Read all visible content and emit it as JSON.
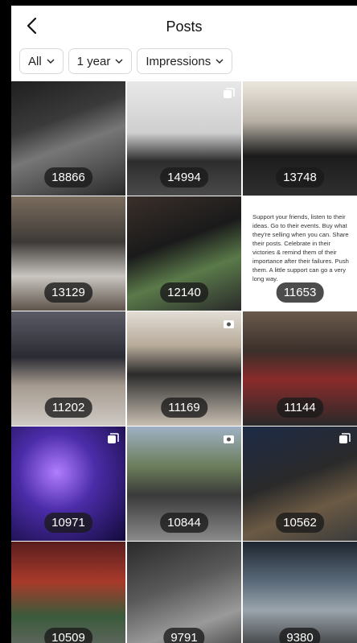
{
  "header": {
    "title": "Posts"
  },
  "filters": [
    {
      "label": "All"
    },
    {
      "label": "1 year"
    },
    {
      "label": "Impressions"
    }
  ],
  "posts": [
    {
      "count": "18866"
    },
    {
      "count": "14994"
    },
    {
      "count": "13748"
    },
    {
      "count": "13129"
    },
    {
      "count": "12140"
    },
    {
      "count": "11653",
      "caption": "Support your friends, listen to their ideas. Go to their events. Buy what they're selling when you can. Share their posts. Celebrate in their victories & remind them of their importance after their failures. Push them. A little support can go a very long way."
    },
    {
      "count": "11202"
    },
    {
      "count": "11169"
    },
    {
      "count": "11144"
    },
    {
      "count": "10971"
    },
    {
      "count": "10844"
    },
    {
      "count": "10562"
    },
    {
      "count": "10509"
    },
    {
      "count": "9791"
    },
    {
      "count": "9380"
    }
  ],
  "icons": {
    "back": "back-arrow-icon",
    "chevron": "chevron-down-icon",
    "carousel": "carousel-icon",
    "video": "video-icon"
  }
}
